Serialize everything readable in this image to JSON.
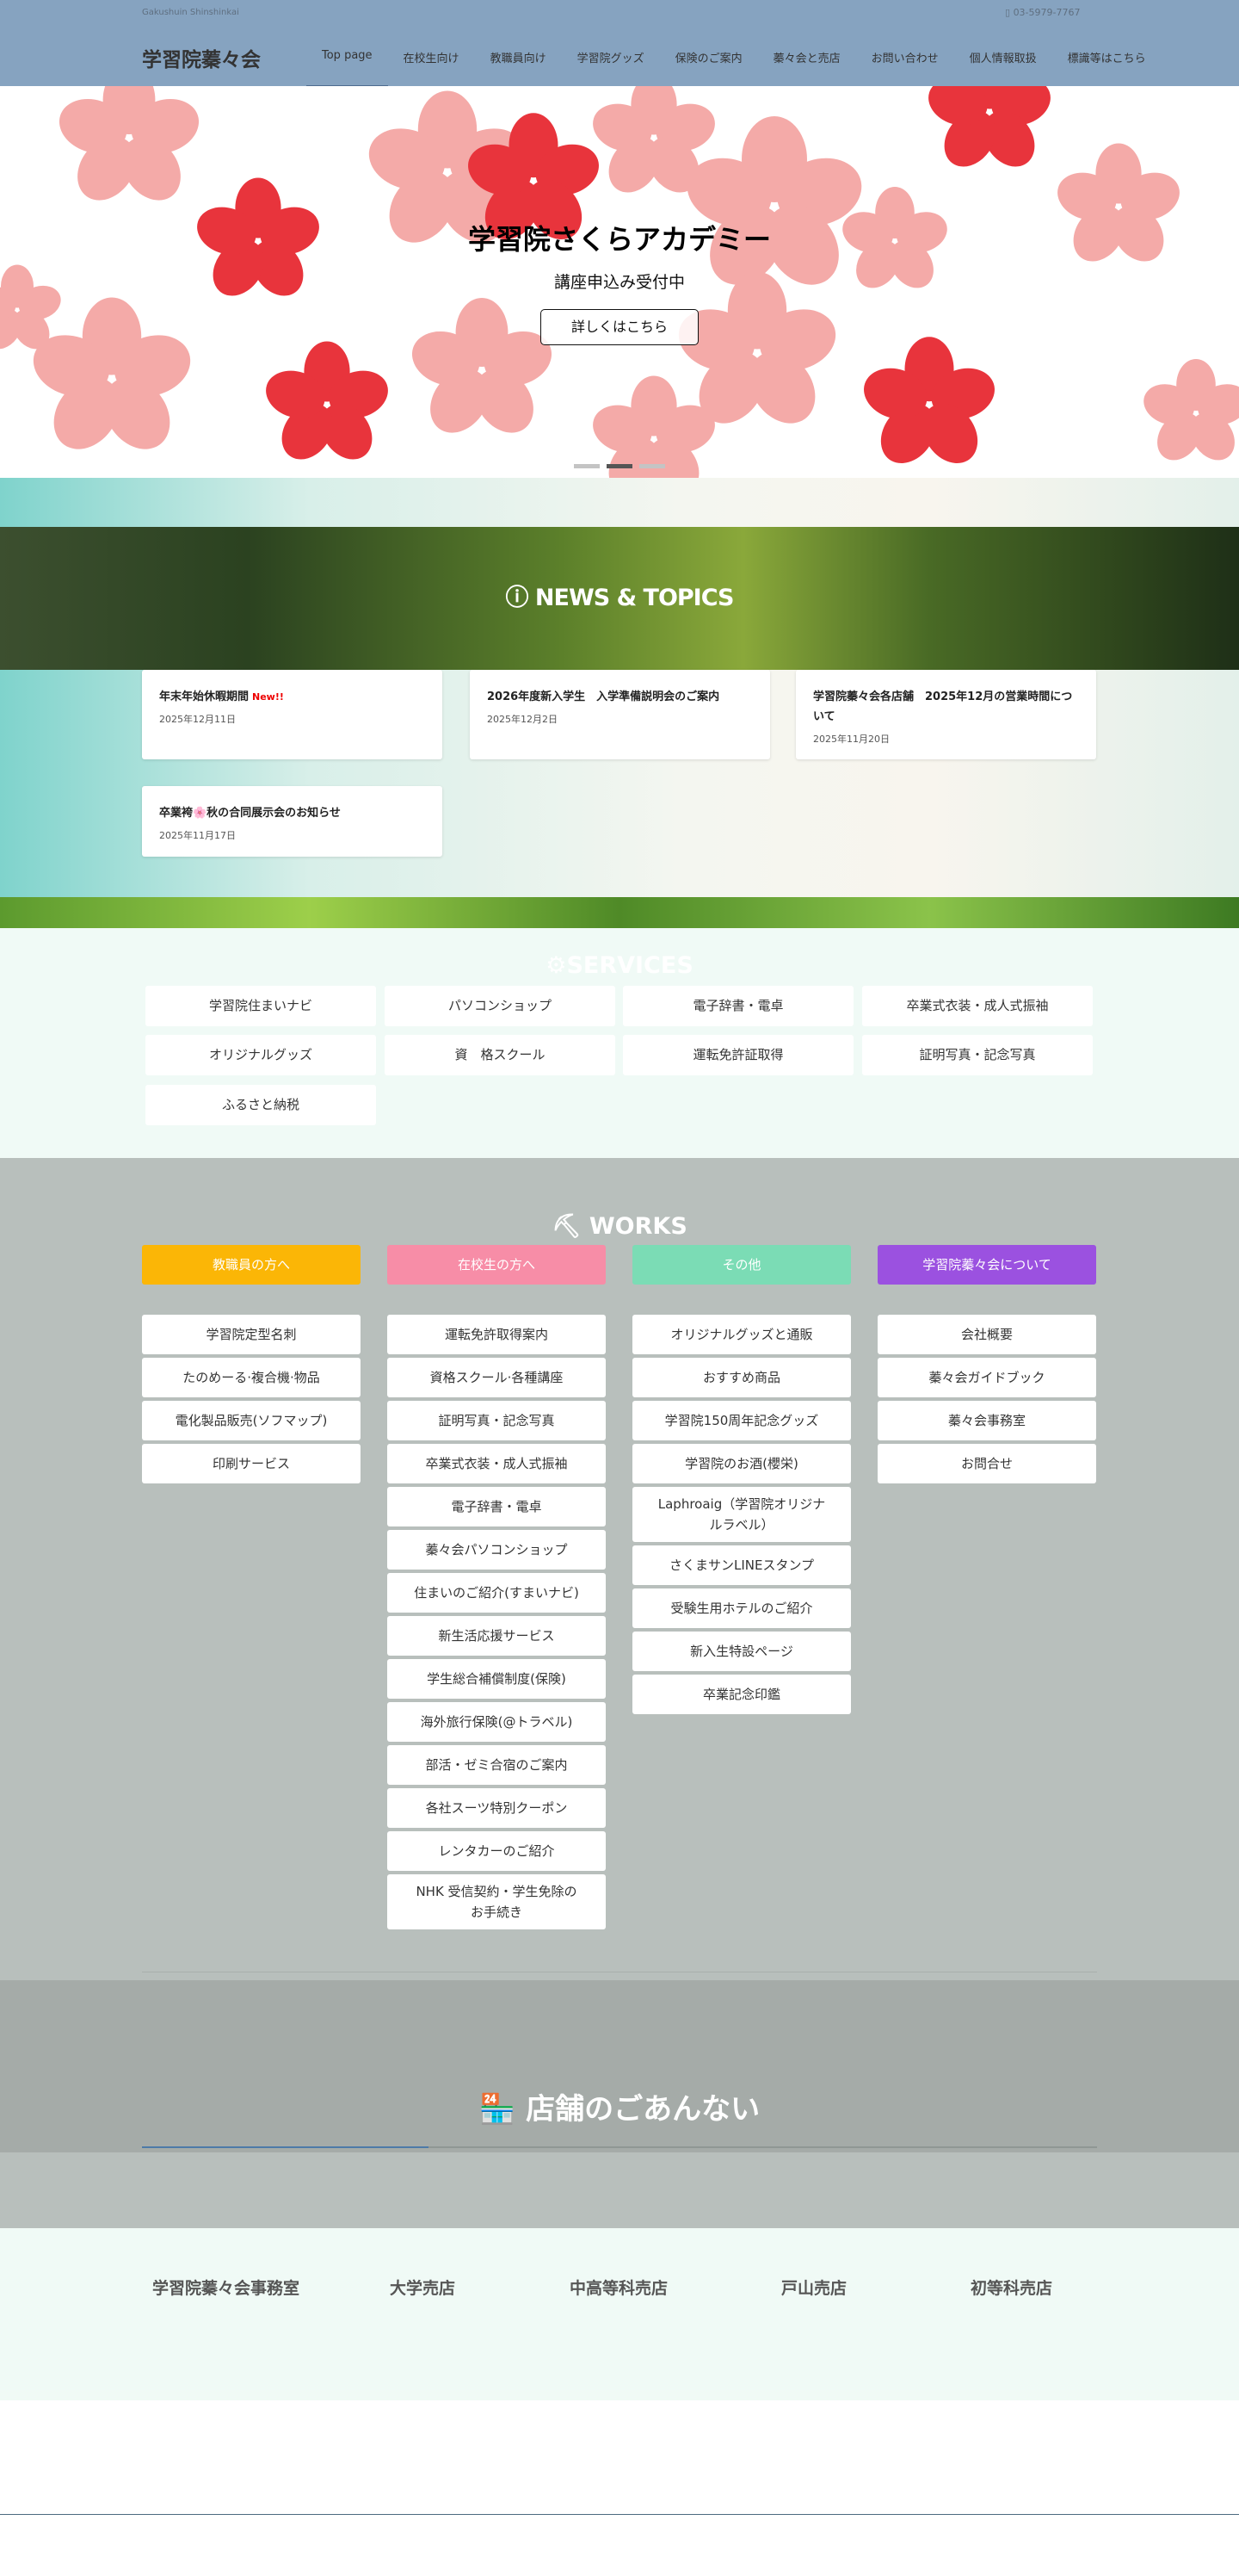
{
  "header": {
    "tagline": "Gakushuin Shinshinkai",
    "phone": "03-5979-7767",
    "logo": "学習院蓁々会",
    "nav": [
      "Top page",
      "在校生向け",
      "教職員向け",
      "学習院グッズ",
      "保険のご案内",
      "蓁々会と売店",
      "お問い合わせ",
      "個人情報取扱",
      "標識等はこちら"
    ]
  },
  "hero": {
    "title": "学習院さくらアカデミー",
    "subtitle": "講座申込み受付中",
    "button": "詳しくはこちら",
    "slides": 3,
    "active_slide": 2
  },
  "news": {
    "title": "NEWS & TOPICS",
    "new_badge": "New!!",
    "items": [
      {
        "title": "年末年始休暇期間",
        "date": "2025年12月11日"
      },
      {
        "title": "2026年度新入学生　入学準備説明会のご案内",
        "date": "2025年12月2日"
      },
      {
        "title": "学習院蓁々会各店舗　2025年12月の営業時間について",
        "date": "2025年11月20日"
      },
      {
        "title": "卒業袴🌸秋の合同展示会のお知らせ",
        "date": "2025年11月17日"
      }
    ]
  },
  "services": {
    "title": "SERVICES",
    "items": [
      "学習院住まいナビ",
      "パソコンショップ",
      "電子辞書・電卓",
      "卒業式衣装・成人式振袖",
      "オリジナルグッズ",
      "資　格スクール",
      "運転免許証取得",
      "証明写真・記念写真",
      "ふるさと納税"
    ]
  },
  "works": {
    "title": "WORKS",
    "columns": [
      {
        "header": "教職員の方へ",
        "color": "#fbb606",
        "items": [
          "学習院定型名刺",
          "たのめーる·複合機·物品",
          "電化製品販売(ソフマップ)",
          "印刷サービス"
        ]
      },
      {
        "header": "在校生の方へ",
        "color": "#f78da7",
        "items": [
          "運転免許取得案内",
          "資格スクール·各種講座",
          "証明写真・記念写真",
          "卒業式衣装・成人式振袖",
          "電子辞書・電卓",
          "蓁々会パソコンショップ",
          "住まいのご紹介(すまいナビ)",
          "新生活応援サービス",
          "学生総合補償制度(保険)",
          "海外旅行保険(@トラベル)",
          "部活・ゼミ合宿のご案内",
          "各社スーツ特別クーポン",
          "レンタカーのご紹介",
          "NHK 受信契約・学生免除のお手続き"
        ]
      },
      {
        "header": "その他",
        "color": "#7bdcb5",
        "items": [
          "オリジナルグッズと通販",
          "おすすめ商品",
          "学習院150周年記念グッズ",
          "学習院のお酒(櫻栄)",
          "Laphroaig（学習院オリジナルラベル）",
          "さくまサンLINEスタンプ",
          "受験生用ホテルのご紹介",
          "新入生特設ページ",
          "卒業記念印鑑"
        ]
      },
      {
        "header": "学習院蓁々会について",
        "color": "#9b51e0",
        "items": [
          "会社概要",
          "蓁々会ガイドブック",
          "蓁々会事務室",
          "お問合せ"
        ]
      }
    ]
  },
  "stores": {
    "title": "店舗のごあんない",
    "tabs": [
      "学習院蓁々会事務室",
      "大学売店",
      "中高等科売店",
      "戸山売店",
      "初等科売店"
    ]
  }
}
